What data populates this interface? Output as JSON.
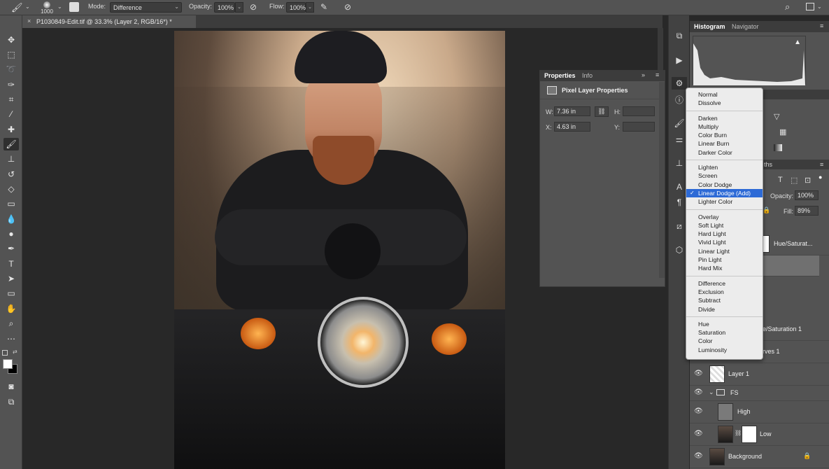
{
  "options_bar": {
    "brush_size": "1000",
    "mode_label": "Mode:",
    "mode_value": "Difference",
    "opacity_label": "Opacity:",
    "opacity_value": "100%",
    "flow_label": "Flow:",
    "flow_value": "100%"
  },
  "document_tab": {
    "title": "P1030849-Edit.tif @ 33.3% (Layer 2, RGB/16*) *",
    "close": "×"
  },
  "properties": {
    "tabs": [
      "Properties",
      "Info"
    ],
    "heading": "Pixel Layer Properties",
    "w_label": "W:",
    "w_value": "7.36 in",
    "h_label": "H:",
    "h_value": "",
    "x_label": "X:",
    "x_value": "4.63 in",
    "y_label": "Y:",
    "y_value": ""
  },
  "histogram_panel": {
    "tabs": [
      "Histogram",
      "Navigator"
    ]
  },
  "panel_fragments": {
    "paths_tab_fragment": "ths",
    "opacity_label": "Opacity:",
    "opacity_value": "100%",
    "fill_label": "Fill:",
    "fill_value": "89%"
  },
  "layers": [
    {
      "name": "Hue/Saturat...",
      "fragment": true
    },
    {
      "name": "e/Saturation 1",
      "fragment": true
    },
    {
      "name": "rves 1",
      "fragment": true
    },
    {
      "name": "Layer 1"
    },
    {
      "name": "FS"
    },
    {
      "name": "High"
    },
    {
      "name": "Low"
    },
    {
      "name": "Background"
    }
  ],
  "blend_modes": {
    "groups": [
      [
        "Normal",
        "Dissolve"
      ],
      [
        "Darken",
        "Multiply",
        "Color Burn",
        "Linear Burn",
        "Darker Color"
      ],
      [
        "Lighten",
        "Screen",
        "Color Dodge",
        "Linear Dodge (Add)",
        "Lighter Color"
      ],
      [
        "Overlay",
        "Soft Light",
        "Hard Light",
        "Vivid Light",
        "Linear Light",
        "Pin Light",
        "Hard Mix"
      ],
      [
        "Difference",
        "Exclusion",
        "Subtract",
        "Divide"
      ],
      [
        "Hue",
        "Saturation",
        "Color",
        "Luminosity"
      ]
    ],
    "selected": "Linear Dodge (Add)"
  },
  "colors": {
    "ui_bg": "#535353",
    "menu_highlight": "#2d6ad6",
    "foreground_swatch": "#ffffff",
    "background_swatch": "#000000"
  }
}
